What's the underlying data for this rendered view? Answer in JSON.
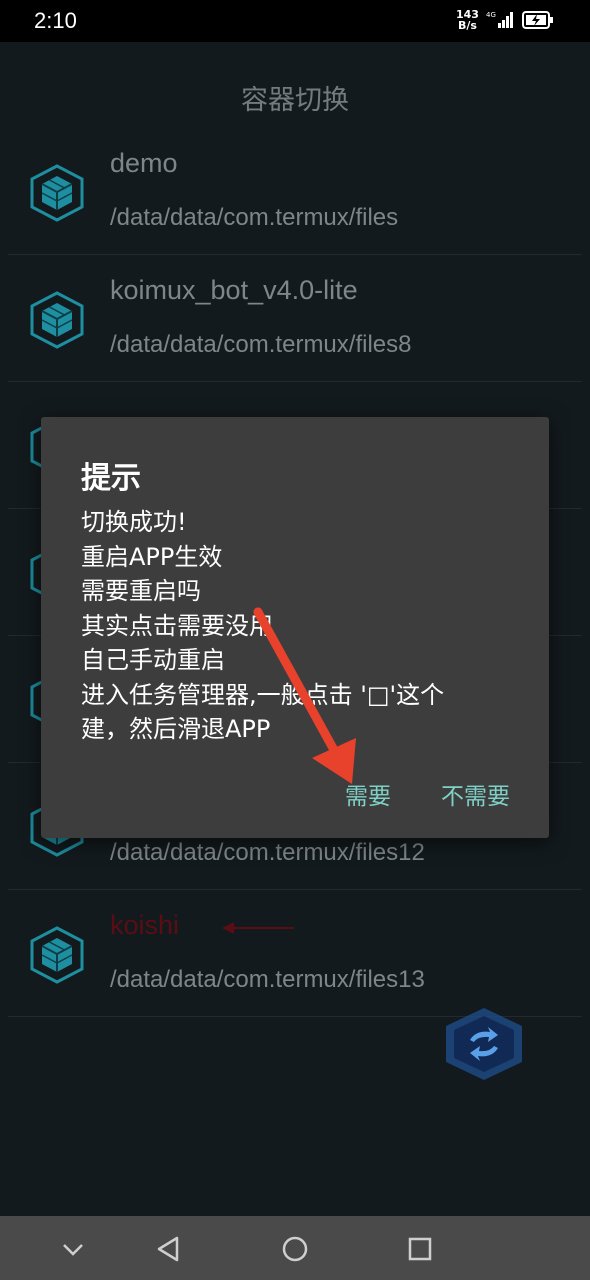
{
  "status": {
    "time": "2:10",
    "speed_value": "143",
    "speed_unit": "B/s",
    "network": "4G"
  },
  "page": {
    "title": "容器切换"
  },
  "containers": [
    {
      "name": "demo",
      "path": "/data/data/com.termux/files"
    },
    {
      "name": "koimux_bot_v4.0-lite",
      "path": "/data/data/com.termux/files8"
    },
    {
      "name": "",
      "path": ""
    },
    {
      "name": "",
      "path": ""
    },
    {
      "name": "",
      "path": ""
    },
    {
      "name": "",
      "path": "/data/data/com.termux/files12"
    },
    {
      "name": "koishi",
      "path": "/data/data/com.termux/files13"
    }
  ],
  "dialog": {
    "title": "提示",
    "lines": [
      "切换成功!",
      "重启APP生效",
      "需要重启吗",
      "其实点击需要没用",
      "自己手动重启",
      "进入任务管理器,一般点击 '□'这个",
      "建，然后滑退APP"
    ],
    "yes_label": "需要",
    "no_label": "不需要"
  },
  "colors": {
    "accent": "#7fd0c6",
    "icon": "#1d8fa0",
    "arrow": "#e8412c",
    "selected": "#5a0d14"
  }
}
